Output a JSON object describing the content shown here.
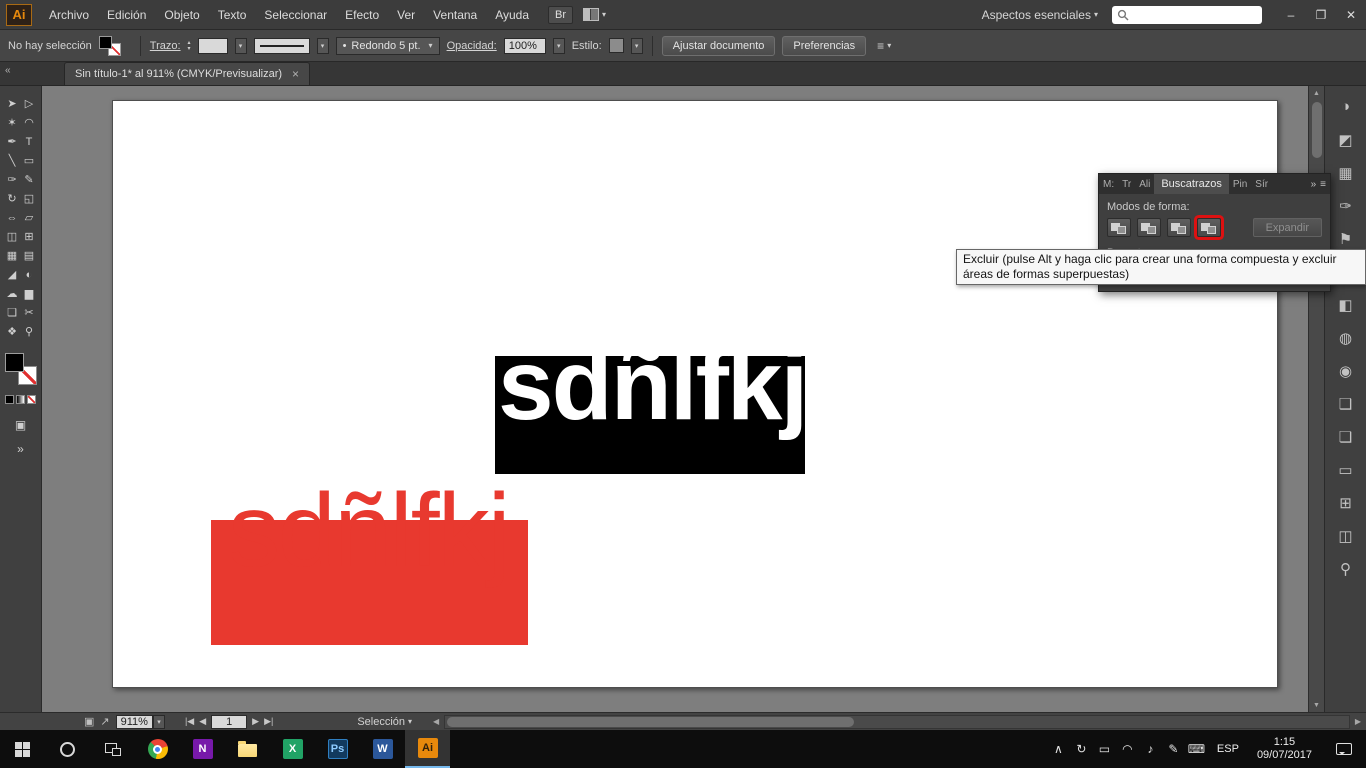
{
  "colors": {
    "artwork_red": "#e8392f",
    "highlight_red": "#dd1111",
    "illustrator_orange": "#e8890c",
    "onenote_purple": "#7719aa",
    "word_blue": "#2b579a",
    "excel_green": "#21a366",
    "folder_yellow": "#f8d775"
  },
  "icons": {
    "caret_down": "▾",
    "double_chevron_left": "«",
    "double_chevron_right": "»",
    "panel_menu": "≡",
    "stepper_up": "▴",
    "stepper_down": "▾",
    "scroll_up": "▲",
    "scroll_down": "▼",
    "fit_view": "▣",
    "launch_view": "↗",
    "bullet": "•",
    "expander": "▶"
  },
  "menubar": {
    "logo": "Ai",
    "items": [
      {
        "name": "menu-archivo",
        "label": "Archivo"
      },
      {
        "name": "menu-edicion",
        "label": "Edición"
      },
      {
        "name": "menu-objeto",
        "label": "Objeto"
      },
      {
        "name": "menu-texto",
        "label": "Texto"
      },
      {
        "name": "menu-seleccionar",
        "label": "Seleccionar"
      },
      {
        "name": "menu-efecto",
        "label": "Efecto"
      },
      {
        "name": "menu-ver",
        "label": "Ver"
      },
      {
        "name": "menu-ventana",
        "label": "Ventana"
      },
      {
        "name": "menu-ayuda",
        "label": "Ayuda"
      }
    ],
    "bridge_button": "Br",
    "workspace_switcher": "Aspectos esenciales",
    "search_placeholder": "",
    "window_controls": {
      "minimize": "–",
      "restore": "❐",
      "close": "✕"
    }
  },
  "controlbar": {
    "selection_status": "No hay selección",
    "stroke_label": "Trazo:",
    "brush_preset": "Redondo 5 pt.",
    "opacity_label": "Opacidad:",
    "opacity_value": "100%",
    "style_label": "Estilo:",
    "fit_document_button": "Ajustar documento",
    "preferences_button": "Preferencias"
  },
  "tabbar": {
    "document_title": "Sin título-1* al 911% (CMYK/Previsualizar)",
    "close_glyph": "×"
  },
  "toolbox": {
    "tools": [
      {
        "name": "selection-tool",
        "glyph": "➤"
      },
      {
        "name": "direct-selection-tool",
        "glyph": "▷"
      },
      {
        "name": "magic-wand-tool",
        "glyph": "✶"
      },
      {
        "name": "lasso-tool",
        "glyph": "◠"
      },
      {
        "name": "pen-tool",
        "glyph": "✒"
      },
      {
        "name": "type-tool",
        "glyph": "T"
      },
      {
        "name": "line-segment-tool",
        "glyph": "╲"
      },
      {
        "name": "rectangle-tool",
        "glyph": "▭"
      },
      {
        "name": "paintbrush-tool",
        "glyph": "✑"
      },
      {
        "name": "pencil-tool",
        "glyph": "✎"
      },
      {
        "name": "rotate-tool",
        "glyph": "↻"
      },
      {
        "name": "scale-tool",
        "glyph": "◱"
      },
      {
        "name": "width-tool",
        "glyph": "⇔"
      },
      {
        "name": "free-transform-tool",
        "glyph": "▱"
      },
      {
        "name": "shape-builder-tool",
        "glyph": "◫"
      },
      {
        "name": "perspective-grid-tool",
        "glyph": "⊞"
      },
      {
        "name": "mesh-tool",
        "glyph": "▦"
      },
      {
        "name": "gradient-tool",
        "glyph": "▤"
      },
      {
        "name": "eyedropper-tool",
        "glyph": "◢"
      },
      {
        "name": "blend-tool",
        "glyph": "◐"
      },
      {
        "name": "symbol-sprayer-tool",
        "glyph": "☁"
      },
      {
        "name": "column-graph-tool",
        "glyph": "▆"
      },
      {
        "name": "artboard-tool",
        "glyph": "❏"
      },
      {
        "name": "slice-tool",
        "glyph": "✂"
      },
      {
        "name": "hand-tool",
        "glyph": "❖"
      },
      {
        "name": "zoom-tool",
        "glyph": "⚲"
      }
    ]
  },
  "canvas": {
    "black_shape_text": "sdñlfkj",
    "red_shape_text": "sdñlfkj"
  },
  "pathfinder": {
    "tabs_left": [
      {
        "name": "tab-truncated-1",
        "label": "M:"
      },
      {
        "name": "tab-truncated-2",
        "label": "Tr"
      },
      {
        "name": "tab-truncated-3",
        "label": "Ali"
      }
    ],
    "active_tab": "Buscatrazos",
    "tabs_right": [
      {
        "name": "tab-pin",
        "label": "Pin"
      },
      {
        "name": "tab-sir",
        "label": "Sír"
      }
    ],
    "shape_modes_label": "Modos de forma:",
    "pathfinders_label": "Buscatrazos:",
    "expand_button": "Expandir"
  },
  "tooltip": {
    "text": "Excluir (pulse Alt y haga clic para crear una forma compuesta y excluir áreas de formas superpuestas)"
  },
  "statusbar": {
    "zoom_value": "911%",
    "first_glyph": "|◀",
    "prev_glyph": "◀",
    "artboard_number": "1",
    "next_glyph": "▶",
    "last_glyph": "▶|",
    "status_label": "Selección",
    "left_arrow": "◀",
    "right_arrow": "▶"
  },
  "taskbar": {
    "apps": {
      "onenote_label": "N",
      "excel_label": "X",
      "photoshop_label": "Ps",
      "word_label": "W",
      "illustrator_label": "Ai"
    },
    "tray": {
      "icons": [
        {
          "name": "hidden-icons-chevron",
          "glyph": "∧"
        },
        {
          "name": "sync-icon",
          "glyph": "↻"
        },
        {
          "name": "battery-icon",
          "glyph": "▭"
        },
        {
          "name": "wifi-icon",
          "glyph": "◠"
        },
        {
          "name": "volume-icon",
          "glyph": "♪"
        },
        {
          "name": "pen-icon",
          "glyph": "✎"
        },
        {
          "name": "touch-keyboard-icon",
          "glyph": "⌨"
        }
      ],
      "language": "ESP",
      "time": "1:15",
      "date": "09/07/2017"
    }
  },
  "dock": {
    "icons": [
      {
        "name": "color-panel-icon",
        "glyph": "◑"
      },
      {
        "name": "color-guide-panel-icon",
        "glyph": "◩"
      },
      {
        "name": "swatches-panel-icon",
        "glyph": "▦"
      },
      {
        "name": "brushes-panel-icon",
        "glyph": "✑"
      },
      {
        "name": "symbols-panel-icon",
        "glyph": "⚑"
      },
      {
        "name": "stroke-panel-icon",
        "glyph": "≡"
      },
      {
        "name": "gradient-panel-icon",
        "glyph": "◧"
      },
      {
        "name": "transparency-panel-icon",
        "glyph": "◍"
      },
      {
        "name": "appearance-panel-icon",
        "glyph": "◉"
      },
      {
        "name": "graphic-styles-panel-icon",
        "glyph": "❑"
      },
      {
        "name": "layers-panel-icon",
        "glyph": "❏"
      },
      {
        "name": "artboards-panel-icon",
        "glyph": "▭"
      },
      {
        "name": "align-panel-icon",
        "glyph": "⊞"
      },
      {
        "name": "pathfinder-panel-icon",
        "glyph": "◫"
      },
      {
        "name": "navigator-panel-icon",
        "glyph": "⚲"
      }
    ]
  }
}
